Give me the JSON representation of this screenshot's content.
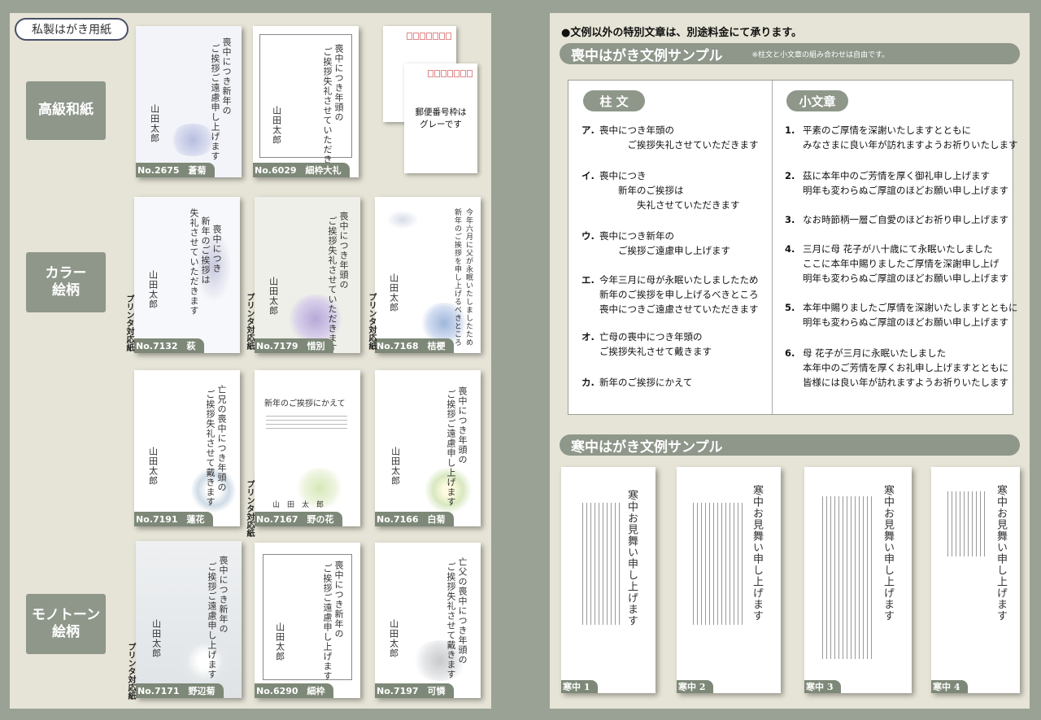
{
  "left": {
    "tag": "私製はがき用紙",
    "categories": [
      {
        "label": "高級和紙"
      },
      {
        "label": "カラー\n絵柄"
      },
      {
        "label": "モノトーン\n絵柄"
      }
    ],
    "printer_note": "プリンタ対応紙",
    "postcard_note": "郵便番号枠は\nグレーです",
    "cards": [
      {
        "no": "No.2675　蒼菊",
        "msg1": "喪中につき新年の",
        "msg2": "ご挨拶ご遠慮申し上げます",
        "name1": "山",
        "name2": "田",
        "name3": "太",
        "name4": "郎"
      },
      {
        "no": "No.6029　細枠大礼",
        "msg1": "喪中につき年頭の",
        "msg2": "ご挨拶失礼させていただきます",
        "name1": "山",
        "name2": "田",
        "name3": "太",
        "name4": "郎"
      },
      {
        "no": "No.7132　萩",
        "msg1": "喪中につき",
        "msg2": "新年のご挨拶は",
        "msg3": "失礼させていただきます",
        "name1": "山",
        "name2": "田",
        "name3": "太",
        "name4": "郎"
      },
      {
        "no": "No.7179　惜別",
        "msg1": "喪中につき年頭の",
        "msg2": "ご挨拶失礼させていただきます",
        "name1": "山",
        "name2": "田",
        "name3": "太",
        "name4": "郎"
      },
      {
        "no": "No.7168　桔梗",
        "msg1": "今年六月に父が永眠いたしましたため",
        "msg2": "新年のご挨拶を申し上げるべきところ",
        "name1": "山",
        "name2": "田",
        "name3": "太",
        "name4": "郎"
      },
      {
        "no": "No.7191　蓮花",
        "msg1": "亡兄の喪中につき年頭の",
        "msg2": "ご挨拶失礼させて戴きます",
        "name1": "山",
        "name2": "田",
        "name3": "太",
        "name4": "郎"
      },
      {
        "no": "No.7167　野の花",
        "header": "新年のご挨拶にかえて",
        "name": "山　田　太　郎"
      },
      {
        "no": "No.7166　白菊",
        "msg1": "喪中につき年頭の",
        "msg2": "ご挨拶ご遠慮申し上げます",
        "name1": "山",
        "name2": "田",
        "name3": "太",
        "name4": "郎"
      },
      {
        "no": "No.7171　野辺菊",
        "msg1": "喪中につき新年の",
        "msg2": "ご挨拶ご遠慮申し上げます",
        "name1": "山",
        "name2": "田",
        "name3": "太",
        "name4": "郎"
      },
      {
        "no": "No.6290　細枠",
        "msg1": "喪中につき新年の",
        "msg2": "ご挨拶ご遠慮申し上げます",
        "name1": "山",
        "name2": "田",
        "name3": "太",
        "name4": "郎"
      },
      {
        "no": "No.7197　可憐",
        "msg1": "亡父の喪中につき年頭の",
        "msg2": "ご挨拶失礼させて戴きます",
        "name1": "山",
        "name2": "田",
        "name3": "太",
        "name4": "郎"
      }
    ]
  },
  "right": {
    "notice": "●文例以外の特別文章は、別途料金にて承ります。",
    "mochu_title": "喪中はがき文例サンプル",
    "mochu_note": "※柱文と小文章の組み合わせは自由です。",
    "hashira_label": "柱 文",
    "kobunsho_label": "小文章",
    "hashira": [
      {
        "mark": "ア.",
        "lines": [
          "喪中につき年頭の",
          "　　　ご挨拶失礼させていただきます"
        ]
      },
      {
        "mark": "イ.",
        "lines": [
          "喪中につき",
          "　　新年のご挨拶は",
          "　　　　失礼させていただきます"
        ]
      },
      {
        "mark": "ウ.",
        "lines": [
          "喪中につき新年の",
          "　　ご挨拶ご遠慮申し上げます"
        ]
      },
      {
        "mark": "エ.",
        "lines": [
          "今年三月に母が永眠いたしましたため",
          "新年のご挨拶を申し上げるべきところ",
          "喪中につきご遠慮させていただきます"
        ]
      },
      {
        "mark": "オ.",
        "lines": [
          "亡母の喪中につき年頭の",
          "ご挨拶失礼させて戴きます"
        ]
      },
      {
        "mark": "カ.",
        "lines": [
          "新年のご挨拶にかえて"
        ]
      }
    ],
    "kobunsho": [
      {
        "mark": "1.",
        "lines": [
          "平素のご厚情を深謝いたしますとともに",
          "みなさまに良い年が訪れますようお祈りいたします"
        ]
      },
      {
        "mark": "2.",
        "lines": [
          "茲に本年中のご芳情を厚く御礼申し上げます",
          "明年も変わらぬご厚誼のほどお願い申し上げます"
        ]
      },
      {
        "mark": "3.",
        "lines": [
          "なお時節柄一層ご自愛のほどお祈り申し上げます"
        ]
      },
      {
        "mark": "4.",
        "lines": [
          "三月に母 花子が八十歳にて永眠いたしました",
          "ここに本年中賜りましたご厚情を深謝申し上げ",
          "明年も変わらぬご厚誼のほどお願い申し上げます"
        ]
      },
      {
        "mark": "5.",
        "lines": [
          "本年中賜りましたご厚情を深謝いたしますとともに",
          "明年も変わらぬご厚誼のほどお願い申し上げます"
        ]
      },
      {
        "mark": "6.",
        "lines": [
          "母 花子が三月に永眠いたしました",
          "本年中のご芳情を厚くお礼申し上げますとともに",
          "皆様には良い年が訪れますようお祈りいたします"
        ]
      }
    ],
    "kanchu_title": "寒中はがき文例サンプル",
    "kanchu": [
      {
        "label": "寒中 1",
        "title": "寒中お見舞い申し上げます"
      },
      {
        "label": "寒中 2",
        "title": "寒中お見舞い申し上げます"
      },
      {
        "label": "寒中 3",
        "title": "寒中お見舞い申し上げます"
      },
      {
        "label": "寒中 4",
        "title": "寒中お見舞い申し上げます"
      }
    ]
  }
}
